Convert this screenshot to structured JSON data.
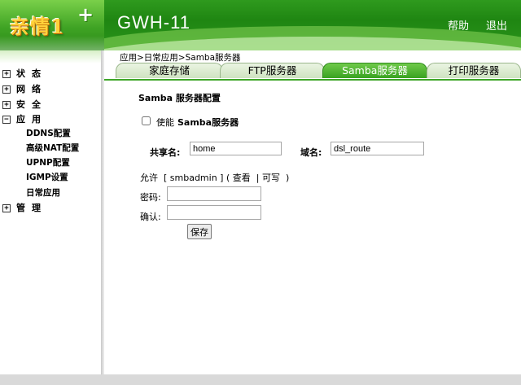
{
  "logo": {
    "text": "亲情1",
    "plus": "+"
  },
  "header": {
    "title": "GWH-11",
    "help": "帮助",
    "logout": "退出"
  },
  "sidebar": {
    "items": [
      {
        "label": "状态",
        "expander": "+"
      },
      {
        "label": "网络",
        "expander": "+"
      },
      {
        "label": "安全",
        "expander": "+"
      },
      {
        "label": "应用",
        "expander": "−"
      },
      {
        "label": "管理",
        "expander": "+"
      }
    ],
    "sub_items": [
      "DDNS配置",
      "高级NAT配置",
      "UPNP配置",
      "IGMP设置",
      "日常应用"
    ]
  },
  "breadcrumb": "应用>日常应用>Samba服务器",
  "tabs": [
    {
      "label": "家庭存储"
    },
    {
      "label": "FTP服务器"
    },
    {
      "label": "Samba服务器",
      "active": true
    },
    {
      "label": "打印服务器"
    }
  ],
  "main": {
    "section_title": "Samba 服务器配置",
    "enable_prefix": "使能",
    "enable_strong": "Samba服务器",
    "enable_checked": false,
    "share_label": "共享名:",
    "share_value": "home",
    "domain_label": "域名:",
    "domain_value": "dsl_route",
    "allow_text": "允许  [ smbadmin ] ( 查看  | 可写  )",
    "password_label": "密码:",
    "confirm_label": "确认:",
    "save_label": "保存"
  },
  "colors": {
    "brand_green": "#2f9a1e",
    "tab_active": "#39a321"
  }
}
